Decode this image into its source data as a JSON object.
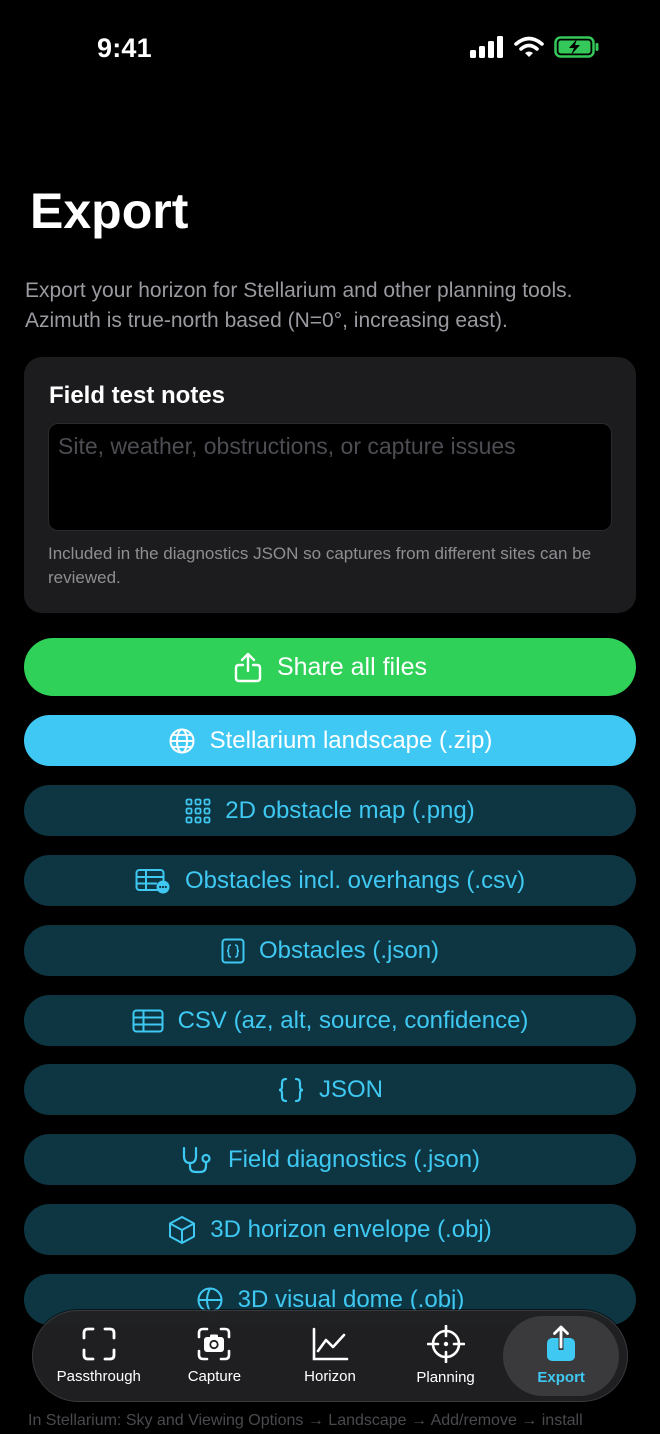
{
  "status": {
    "time": "9:41"
  },
  "page": {
    "title": "Export",
    "subtitle": "Export your horizon for Stellarium and other planning tools. Azimuth is true-north based (N=0°, increasing east)."
  },
  "notes": {
    "title": "Field test notes",
    "placeholder": "Site, weather, obstructions, or capture issues",
    "value": "",
    "help": "Included in the diagnostics JSON so captures from different sites can be reviewed."
  },
  "buttons": {
    "share": "Share all files",
    "stellarium": "Stellarium landscape (.zip)",
    "obstacle_map": "2D obstacle map (.png)",
    "obstacles_csv": "Obstacles incl. overhangs (.csv)",
    "obstacles_json": "Obstacles (.json)",
    "csv": "CSV (az, alt, source, confidence)",
    "json": "JSON",
    "diagnostics": "Field diagnostics (.json)",
    "horizon_obj": "3D horizon envelope (.obj)",
    "dome_obj": "3D visual dome (.obj)"
  },
  "tabs": [
    {
      "label": "Passthrough",
      "icon": "viewfinder-icon"
    },
    {
      "label": "Capture",
      "icon": "camera-icon"
    },
    {
      "label": "Horizon",
      "icon": "chart-line-icon"
    },
    {
      "label": "Planning",
      "icon": "crosshair-icon"
    },
    {
      "label": "Export",
      "icon": "share-icon"
    }
  ],
  "active_tab": "Export",
  "footer_note": "In Stellarium: Sky and Viewing Options → Landscape → Add/remove → install",
  "colors": {
    "share": "#30d158",
    "accent": "#40c8f4",
    "dark_button": "#0e3642"
  }
}
